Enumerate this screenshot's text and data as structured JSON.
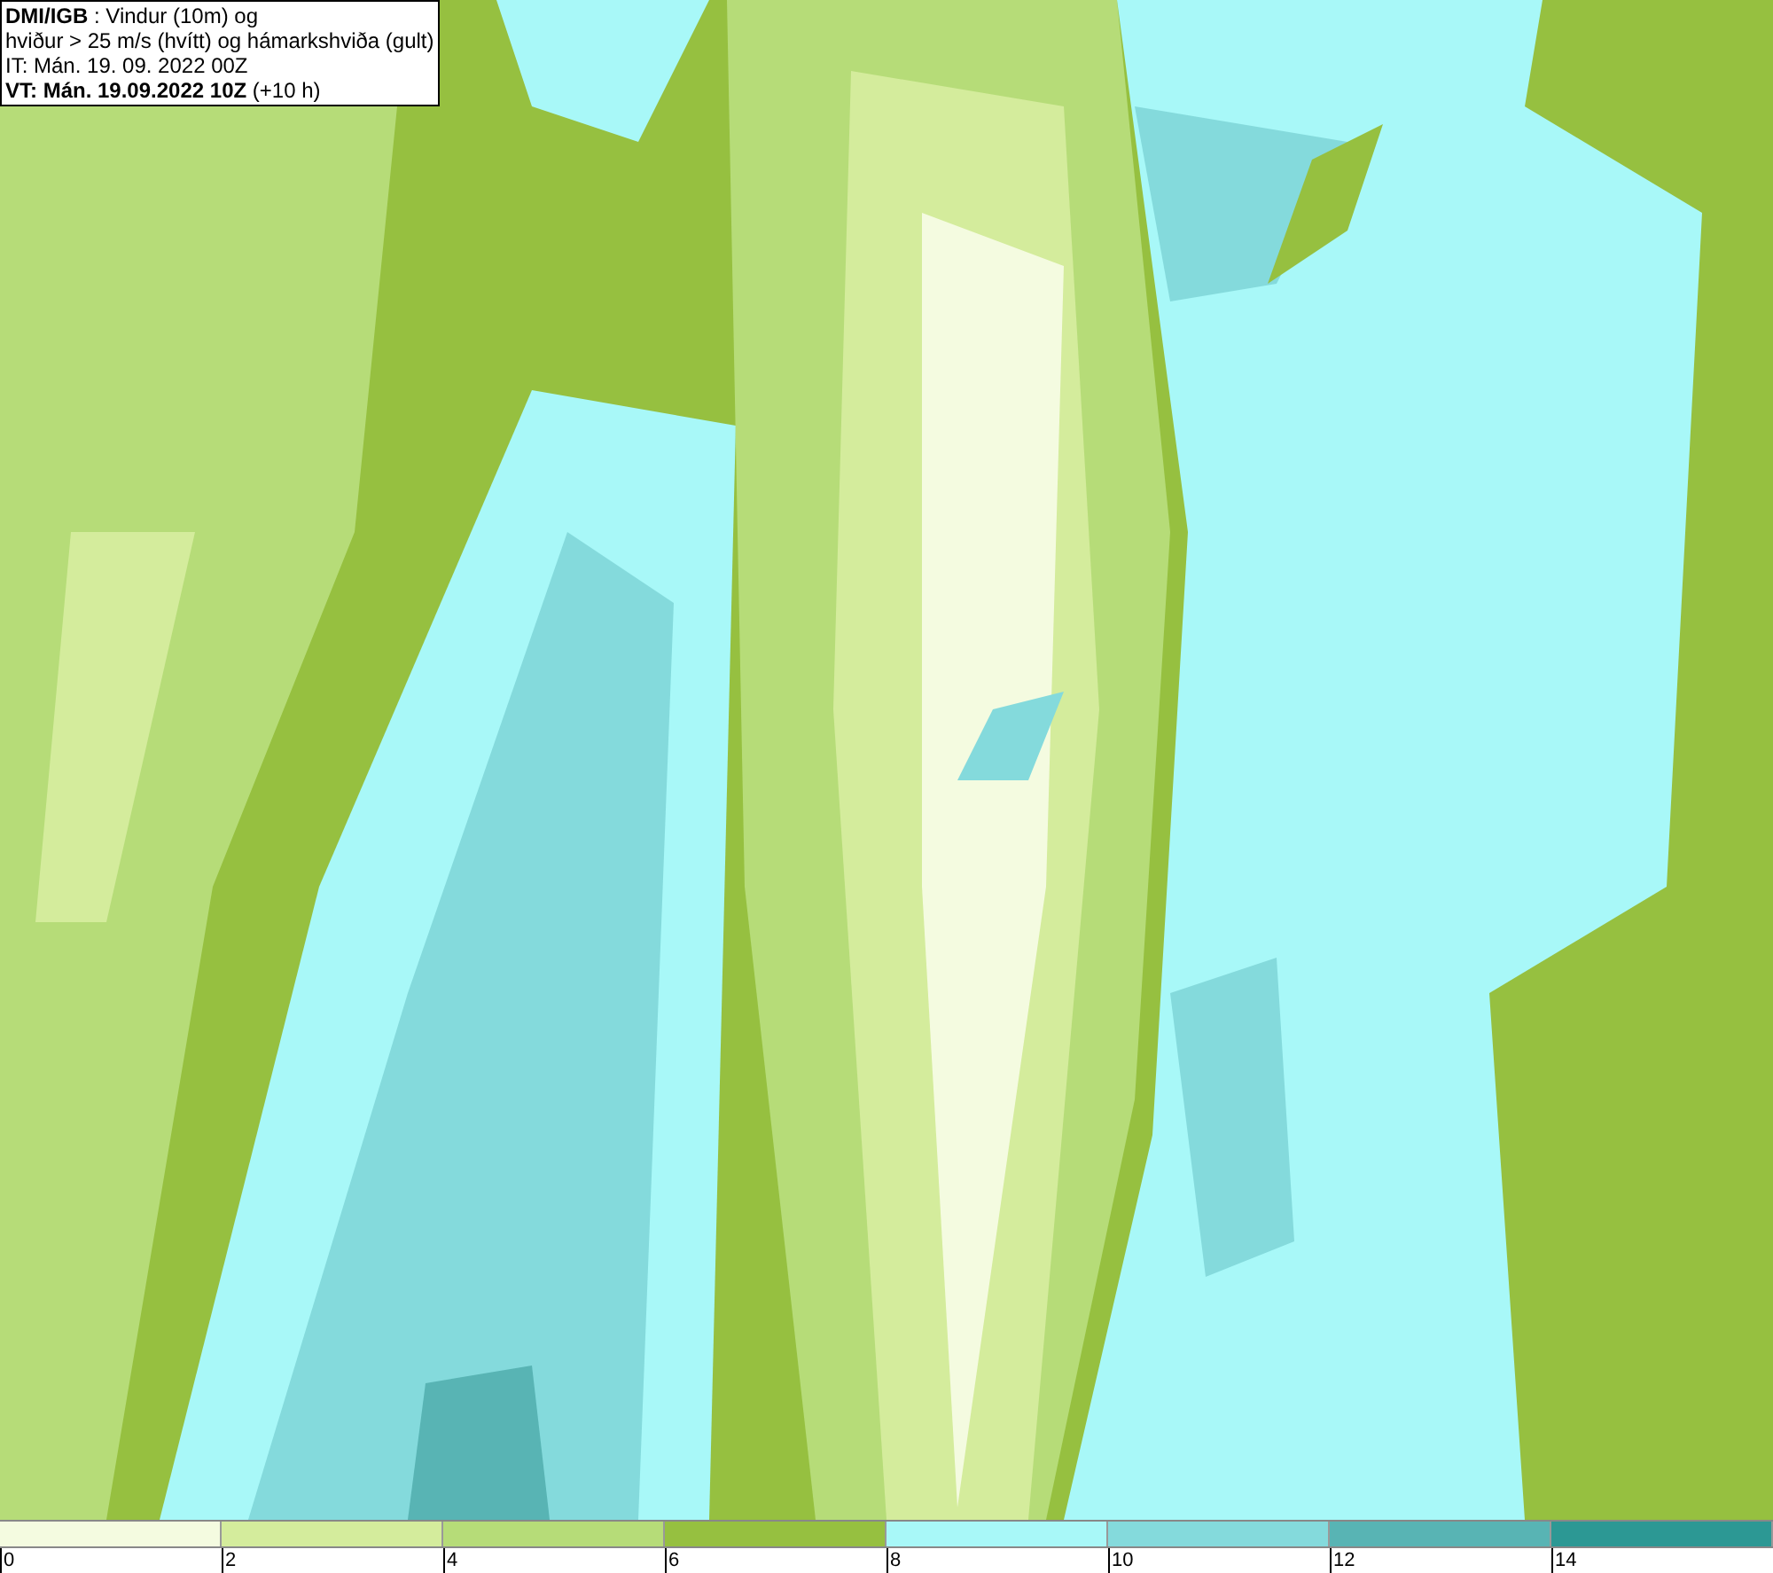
{
  "header": {
    "lines": [
      "**DMI/IGB** : Vindur (10m) og",
      "hviður > 25 m/s (hvítt) og hámarkshviða (gult)",
      "IT: Mán. 19. 09. 2022 00Z",
      "**VT: Mán. 19.09.2022 10Z** (+10 h)"
    ]
  },
  "legend": {
    "segments": [
      {
        "color": "#f4fbe0"
      },
      {
        "color": "#d4ec9c"
      },
      {
        "color": "#b6dc78"
      },
      {
        "color": "#96c040"
      },
      {
        "color": "#a8f8f8"
      },
      {
        "color": "#84dadc"
      },
      {
        "color": "#58b4b4"
      },
      {
        "color": "#2c9894"
      }
    ],
    "ticks": [
      "0",
      "2",
      "4",
      "6",
      "8",
      "10",
      "12",
      "14"
    ]
  }
}
